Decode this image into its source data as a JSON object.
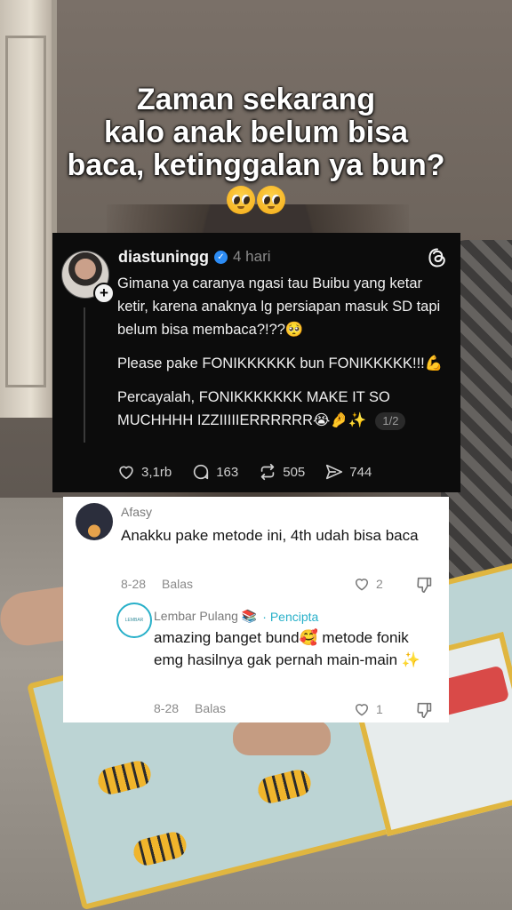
{
  "headline": {
    "line1": "Zaman sekarang",
    "line2": "kalo anak belum bisa",
    "line3": "baca, ketinggalan ya bun?",
    "emoji": "🥺🥺"
  },
  "threads_post": {
    "username": "diastuningg",
    "time": "4 hari",
    "paragraph1": "Gimana ya caranya ngasi tau Buibu yang ketar ketir, karena anaknya lg persiapan masuk SD tapi belum bisa membaca?!??🥺",
    "paragraph2": "Please pake FONIKKKKKK bun FONIKKKKK!!!💪",
    "paragraph3": "Percayalah, FONIKKKKKKK MAKE IT SO MUCHHHH IZZIIIIIERRRRRR😭🤌✨",
    "page_indicator": "1/2",
    "likes": "3,1rb",
    "replies": "163",
    "reposts": "505",
    "shares": "744"
  },
  "comment": {
    "name": "Afasy",
    "text": "Anakku pake metode ini, 4th udah bisa baca",
    "date": "8-28",
    "reply_label": "Balas",
    "likes": "2"
  },
  "reply": {
    "name": "Lembar Pulang 📚",
    "badge": "· Pencipta",
    "text": "amazing banget bund🥰 metode fonik emg hasilnya gak pernah main-main ✨",
    "date": "8-28",
    "reply_label": "Balas",
    "likes": "1"
  },
  "colors": {
    "threads_bg": "#0c0c0c",
    "creator_accent": "#28b0c9",
    "verified_blue": "#2c8cf5"
  },
  "icons": [
    "verified-icon",
    "threads-logo-icon",
    "heart-icon",
    "comment-icon",
    "repost-icon",
    "share-icon",
    "dislike-icon",
    "plus-icon"
  ]
}
